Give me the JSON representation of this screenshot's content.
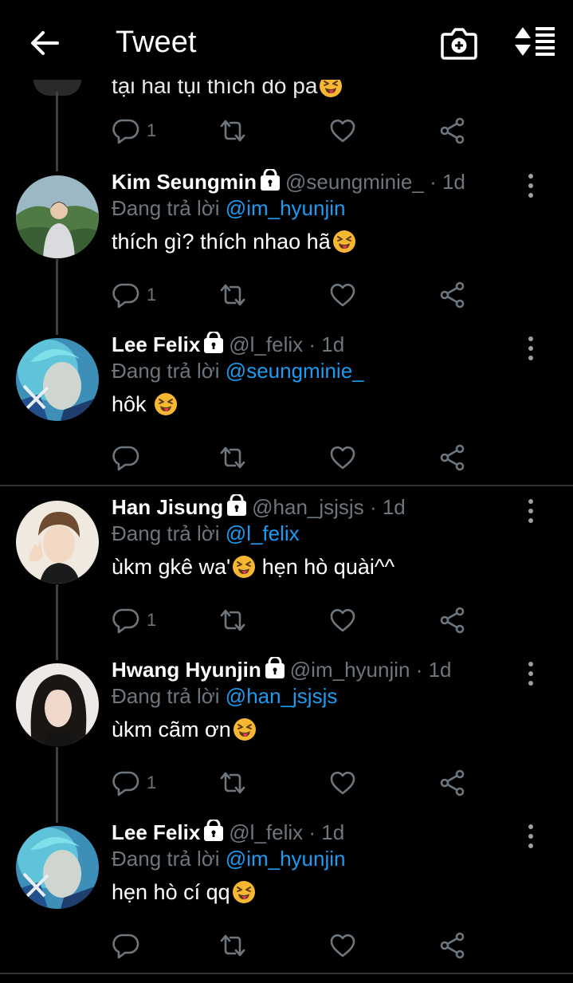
{
  "header": {
    "title": "Tweet"
  },
  "top_partial": {
    "text": "tại hai tụi thích dó pa",
    "reply_count": "1"
  },
  "tweets": [
    {
      "name": "Kim Seungmin",
      "handle": "@seungminie_",
      "time": "· 1d",
      "reply_prefix": "Đang trả lời",
      "reply_to": "@im_hyunjin",
      "text": "thích gì? thích nhao hã",
      "reply_count": "1"
    },
    {
      "name": "Lee Felix",
      "handle": "@l_felix",
      "time": "· 1d",
      "reply_prefix": "Đang trả lời",
      "reply_to": "@seungminie_",
      "text": "hôk ",
      "reply_count": ""
    },
    {
      "name": "Han Jisung",
      "handle": "@han_jsjsjs",
      "time": "· 1d",
      "reply_prefix": "Đang trả lời",
      "reply_to": "@l_felix",
      "text": "ùkm gkê wa'",
      "text_after": " hẹn hò quài^^",
      "reply_count": "1"
    },
    {
      "name": "Hwang Hyunjin",
      "handle": "@im_hyunjin",
      "time": "· 1d",
      "reply_prefix": "Đang trả lời",
      "reply_to": "@han_jsjsjs",
      "text": "ùkm cãm ơn",
      "reply_count": "1"
    },
    {
      "name": "Lee Felix",
      "handle": "@l_felix",
      "time": "· 1d",
      "reply_prefix": "Đang trả lời",
      "reply_to": "@im_hyunjin",
      "text": "hẹn hò cí qq",
      "reply_count": ""
    }
  ],
  "colors": {
    "background": "#000000",
    "link": "#1d9bf0",
    "muted": "#6e767d",
    "divider": "#2f3336",
    "emoji": "#f7b733"
  },
  "icons": [
    "back-arrow-icon",
    "camera-plus-icon",
    "sort-icon",
    "lock-icon",
    "more-vertical-icon",
    "reply-icon",
    "retweet-icon",
    "like-icon",
    "share-icon",
    "squinting-tongue-emoji"
  ]
}
